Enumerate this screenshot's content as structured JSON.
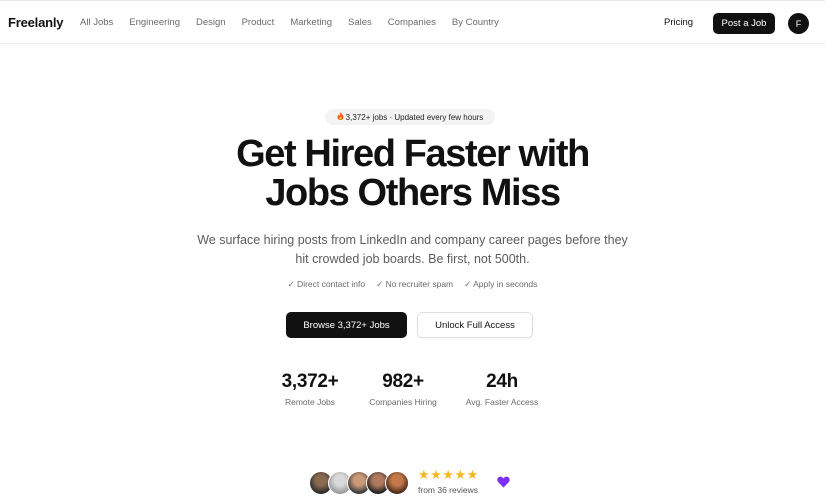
{
  "header": {
    "logo": "Freelanly",
    "nav": [
      "All Jobs",
      "Engineering",
      "Design",
      "Product",
      "Marketing",
      "Sales",
      "Companies",
      "By Country"
    ],
    "pricing": "Pricing",
    "post_job": "Post a Job",
    "avatar_initial": "F"
  },
  "hero": {
    "badge_icon": "fire-icon",
    "badge_text": "3,372+ jobs · Updated every few hours",
    "headline_line1": "Get Hired Faster with",
    "headline_line2": "Jobs Others Miss",
    "subtitle": "We surface hiring posts from LinkedIn and company career pages before they hit crowded job boards. Be first, not 500th.",
    "checks": [
      "✓ Direct contact info",
      "✓ No recruiter spam",
      "✓ Apply in seconds"
    ],
    "browse_button": "Browse 3,372+ Jobs",
    "unlock_button": "Unlock Full Access"
  },
  "stats": [
    {
      "value": "3,372+",
      "label": "Remote Jobs"
    },
    {
      "value": "982+",
      "label": "Companies Hiring"
    },
    {
      "value": "24h",
      "label": "Avg. Faster Access"
    }
  ],
  "social_proof": {
    "rating_stars": 5,
    "stars": "★★★★★",
    "reviews": "from 36 reviews",
    "heart_icon": "purple-heart-icon"
  },
  "colors": {
    "primary": "#111111",
    "muted": "#6b6b6b",
    "star": "#f5b820",
    "heart": "#7b2ff2"
  }
}
